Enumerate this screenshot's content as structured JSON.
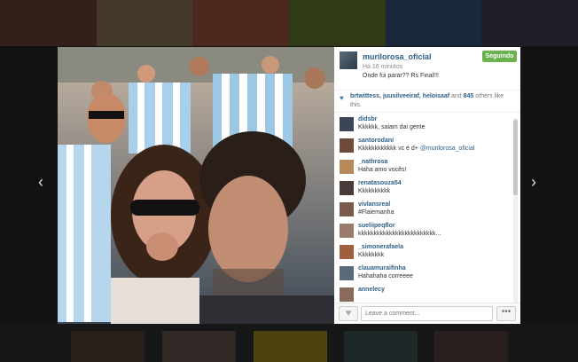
{
  "post": {
    "username": "murilorosa_oficial",
    "time": "Há 16 minutos",
    "caption": "Onde fui parar?? Rs Final!!!",
    "follow_label": "Seguindo"
  },
  "likes": {
    "names": "brtwittess, juusilveeiraf, heloisaaf",
    "connector": " and ",
    "count": "845",
    "suffix": " others like this."
  },
  "comments": [
    {
      "user": "didsbr",
      "text": "Kkkkkk, saiam dai gente",
      "avatar": "#3a4656"
    },
    {
      "user": "santorodani",
      "text": "Kkkkkkkkkkkk vc é d+ ",
      "mention": "@murilorosa_oficial",
      "avatar": "#6e4a3a"
    },
    {
      "user": "_nathrosa",
      "text": "Haha amo vocês!",
      "avatar": "#b88a5a"
    },
    {
      "user": "renatasouza54",
      "text": "Kkkkkkkkkk",
      "avatar": "#4a3a3a"
    },
    {
      "user": "vivlansreal",
      "text": "#Flaiemanha",
      "avatar": "#7a5a4a"
    },
    {
      "user": "sueliipeqflor",
      "text": "kkkkkkkkkkkkkkkkkkkkkkkkk...",
      "avatar": "#9a7a6a"
    },
    {
      "user": "_simonerafaela",
      "text": "Kkkkkkkk",
      "avatar": "#a06040"
    },
    {
      "user": "clauamuraifinha",
      "text": "Hahahaha correeee",
      "avatar": "#5a6a7a"
    },
    {
      "user": "annelecy",
      "text": "",
      "avatar": "#8a6a5a"
    }
  ],
  "footer": {
    "input_placeholder": "Leave a comment...",
    "more_label": "•••"
  },
  "nav": {
    "prev": "‹",
    "next": "›"
  },
  "icons": {
    "like": "heart-icon",
    "likes_indicator": "heart-icon",
    "more": "ellipsis-icon"
  }
}
